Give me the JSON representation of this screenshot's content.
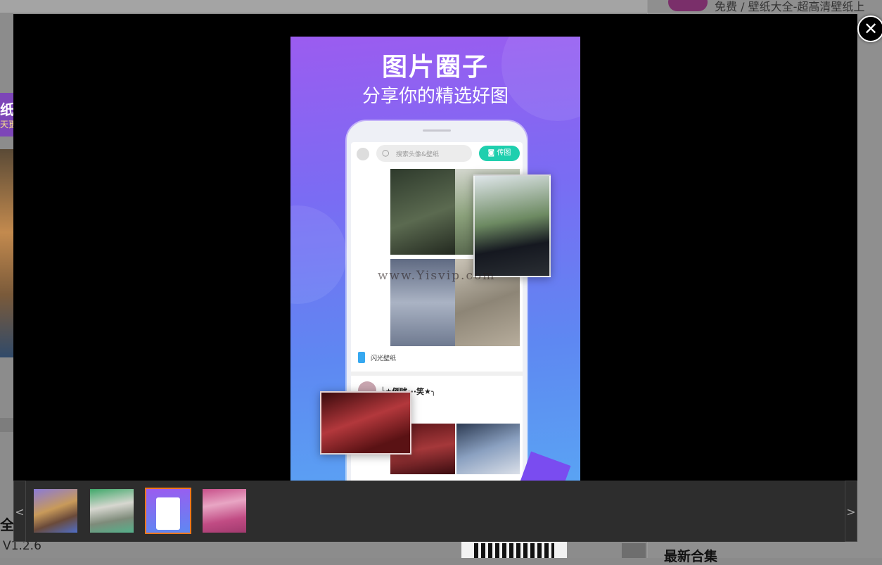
{
  "background_page": {
    "breadcrumb": "免费 / 壁纸大全-超高清壁纸上",
    "left_banner_title": "纸",
    "left_banner_sub": "天更",
    "left_bottom_title": "全",
    "left_version": "V1.2.6",
    "right_heading": "最新合集"
  },
  "lightbox": {
    "close_icon": "✕",
    "main_image": {
      "title": "图片圈子",
      "subtitle": "分享你的精选好图",
      "search_placeholder": "搜索头像&壁纸",
      "upload_button": "传图",
      "app_name": "闪光壁纸",
      "post_author": "╰★倒眸···笑★╮",
      "watermark": "www.Yisvip.com"
    },
    "thumbnails": {
      "prev_label": "<",
      "next_label": ">",
      "items": [
        "thumbnail-1",
        "thumbnail-2",
        "thumbnail-3",
        "thumbnail-4"
      ],
      "selected_index": 2,
      "selected_color": "#f0771c"
    }
  }
}
